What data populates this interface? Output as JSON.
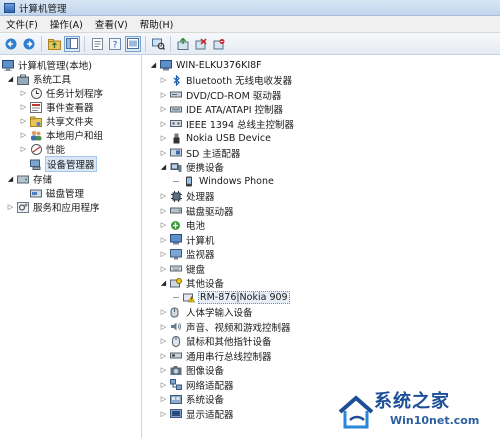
{
  "window": {
    "title": "计算机管理"
  },
  "menu": {
    "file": "文件(F)",
    "action": "操作(A)",
    "view": "查看(V)",
    "help": "帮助(H)"
  },
  "toolbar_icons": [
    "back-arrow-icon",
    "forward-arrow-icon",
    "folder-up-icon",
    "console-tree-icon",
    "properties-icon",
    "help-icon",
    "show-hide-icon",
    "scan-hardware-icon",
    "update-driver-icon",
    "disable-device-icon",
    "uninstall-device-icon"
  ],
  "left_tree": {
    "root": "计算机管理(本地)",
    "system_tools": "系统工具",
    "task_scheduler": "任务计划程序",
    "event_viewer": "事件查看器",
    "shared_folders": "共享文件夹",
    "local_users": "本地用户和组",
    "performance": "性能",
    "device_manager": "设备管理器",
    "storage": "存储",
    "disk_management": "磁盘管理",
    "services_apps": "服务和应用程序"
  },
  "device_tree": {
    "computer_name": "WIN-ELKU376KI8F",
    "categories": [
      {
        "label": "Bluetooth 无线电收发器",
        "icon": "bluetooth-icon"
      },
      {
        "label": "DVD/CD-ROM 驱动器",
        "icon": "dvd-drive-icon"
      },
      {
        "label": "IDE ATA/ATAPI 控制器",
        "icon": "ide-controller-icon"
      },
      {
        "label": "IEEE 1394 总线主控制器",
        "icon": "ieee1394-icon"
      },
      {
        "label": "Nokia USB Device",
        "icon": "usb-plug-icon"
      },
      {
        "label": "SD 主适配器",
        "icon": "sd-adapter-icon"
      },
      {
        "label": "便携设备",
        "icon": "portable-device-icon"
      },
      {
        "label": "Windows Phone",
        "icon": "phone-icon"
      },
      {
        "label": "处理器",
        "icon": "processor-icon"
      },
      {
        "label": "磁盘驱动器",
        "icon": "disk-drive-icon"
      },
      {
        "label": "电池",
        "icon": "battery-icon"
      },
      {
        "label": "计算机",
        "icon": "computer-icon"
      },
      {
        "label": "监视器",
        "icon": "monitor-icon"
      },
      {
        "label": "键盘",
        "icon": "keyboard-icon"
      },
      {
        "label": "其他设备",
        "icon": "other-devices-icon"
      },
      {
        "label": "RM-876|Nokia 909",
        "icon": "unknown-device-warning-icon"
      },
      {
        "label": "人体学输入设备",
        "icon": "hid-icon"
      },
      {
        "label": "声音、视频和游戏控制器",
        "icon": "sound-icon"
      },
      {
        "label": "鼠标和其他指针设备",
        "icon": "mouse-icon"
      },
      {
        "label": "通用串行总线控制器",
        "icon": "usb-controller-icon"
      },
      {
        "label": "图像设备",
        "icon": "imaging-device-icon"
      },
      {
        "label": "网络适配器",
        "icon": "network-adapter-icon"
      },
      {
        "label": "系统设备",
        "icon": "system-device-icon"
      },
      {
        "label": "显示适配器",
        "icon": "display-adapter-icon"
      }
    ]
  },
  "watermark": {
    "title": "系统之家",
    "site": "Win10net.com"
  },
  "colors": {
    "title_bar": "#c3d6ee",
    "selection": "#dbe7f5",
    "watermark": "#1c4f98"
  }
}
